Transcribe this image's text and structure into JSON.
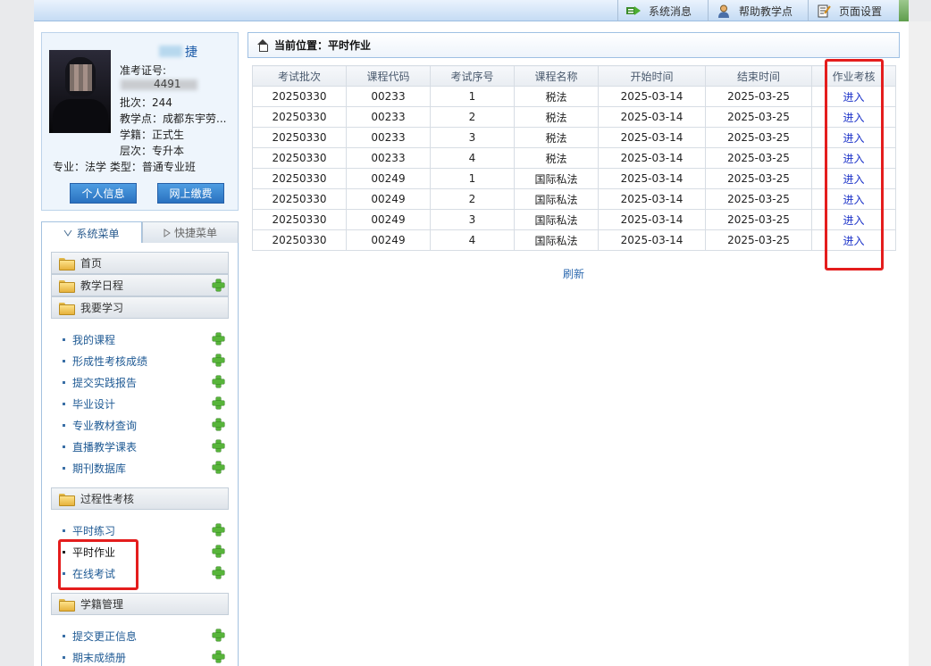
{
  "topbar": {
    "buttons": [
      {
        "label": "系统消息",
        "icon": "message-icon"
      },
      {
        "label": "帮助教学点",
        "icon": "user-help-icon"
      },
      {
        "label": "页面设置",
        "icon": "page-settings-icon"
      }
    ]
  },
  "profile": {
    "name_suffix": "捷",
    "exam_id_label": "准考证号:",
    "exam_id_partial": "4491",
    "batch": "批次：244",
    "site": "教学点：成都东宇劳...",
    "status": "学籍：正式生",
    "level": "层次：专升本",
    "major_type": "专业：法学  类型：普通专业班",
    "buttons": {
      "info": "个人信息",
      "pay": "网上缴费"
    }
  },
  "menu": {
    "tabs": {
      "system": "系统菜单",
      "quick": "快捷菜单"
    },
    "sections": {
      "home": "首页",
      "schedule": "教学日程",
      "study": "我要学习",
      "process": "过程性考核",
      "records": "学籍管理"
    },
    "study_items": [
      "我的课程",
      "形成性考核成绩",
      "提交实践报告",
      "毕业设计",
      "专业教材查询",
      "直播教学课表",
      "期刊数据库"
    ],
    "process_items": [
      "平时练习",
      "平时作业",
      "在线考试"
    ],
    "records_items": [
      "提交更正信息",
      "期末成绩册"
    ]
  },
  "main": {
    "location": "当前位置：平时作业",
    "columns": [
      "考试批次",
      "课程代码",
      "考试序号",
      "课程名称",
      "开始时间",
      "结束时间",
      "作业考核"
    ],
    "rows": [
      [
        "20250330",
        "00233",
        "1",
        "税法",
        "2025-03-14",
        "2025-03-25",
        "进入"
      ],
      [
        "20250330",
        "00233",
        "2",
        "税法",
        "2025-03-14",
        "2025-03-25",
        "进入"
      ],
      [
        "20250330",
        "00233",
        "3",
        "税法",
        "2025-03-14",
        "2025-03-25",
        "进入"
      ],
      [
        "20250330",
        "00233",
        "4",
        "税法",
        "2025-03-14",
        "2025-03-25",
        "进入"
      ],
      [
        "20250330",
        "00249",
        "1",
        "国际私法",
        "2025-03-14",
        "2025-03-25",
        "进入"
      ],
      [
        "20250330",
        "00249",
        "2",
        "国际私法",
        "2025-03-14",
        "2025-03-25",
        "进入"
      ],
      [
        "20250330",
        "00249",
        "3",
        "国际私法",
        "2025-03-14",
        "2025-03-25",
        "进入"
      ],
      [
        "20250330",
        "00249",
        "4",
        "国际私法",
        "2025-03-14",
        "2025-03-25",
        "进入"
      ]
    ],
    "refresh": "刷新"
  },
  "colors": {
    "highlight": "#e41d1d",
    "link": "#1c33c9",
    "accent": "#2a72c0"
  }
}
